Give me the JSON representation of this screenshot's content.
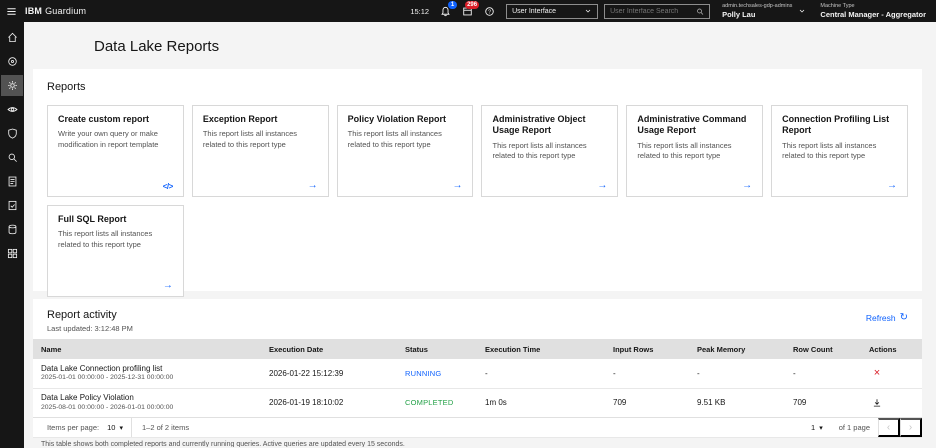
{
  "colors": {
    "accent_blue": "#0f62fe",
    "status_running": "#0f62fe",
    "status_completed": "#24a148",
    "danger_red": "#da1e28"
  },
  "topbar": {
    "brand_bold": "IBM",
    "brand_rest": "Guardium",
    "time": "15:12",
    "notifications_badge": "1",
    "tasks_badge": "296",
    "ui_selector_value": "User Interface",
    "search_placeholder": "User Interface Search",
    "user_group": "admin.techsales-gdp-admins",
    "user_name": "Polly Lau",
    "machine_type_label": "Machine Type",
    "machine_type_value": "Central Manager - Aggregator"
  },
  "sidebar": {
    "items": [
      {
        "name": "home",
        "active": false
      },
      {
        "name": "discover",
        "active": false
      },
      {
        "name": "settings",
        "active": true
      },
      {
        "name": "monitor",
        "active": false
      },
      {
        "name": "protect",
        "active": false
      },
      {
        "name": "search",
        "active": false
      },
      {
        "name": "reports",
        "active": false
      },
      {
        "name": "audit",
        "active": false
      },
      {
        "name": "data",
        "active": false
      },
      {
        "name": "dashboards",
        "active": false
      }
    ]
  },
  "page": {
    "title": "Data Lake Reports"
  },
  "reports": {
    "section_title": "Reports",
    "cards": [
      {
        "title": "Create custom report",
        "description": "Write your own query or make modification in report template",
        "icon": "code-icon",
        "icon_glyph": "</>"
      },
      {
        "title": "Exception Report",
        "description": "This report lists all instances related to this report type",
        "icon": "arrow-right-icon",
        "icon_glyph": "→"
      },
      {
        "title": "Policy Violation Report",
        "description": "This report lists all instances related to this report type",
        "icon": "arrow-right-icon",
        "icon_glyph": "→"
      },
      {
        "title": "Administrative Object Usage Report",
        "description": "This report lists all instances related to this report type",
        "icon": "arrow-right-icon",
        "icon_glyph": "→"
      },
      {
        "title": "Administrative Command Usage Report",
        "description": "This report lists all instances related to this report type",
        "icon": "arrow-right-icon",
        "icon_glyph": "→"
      },
      {
        "title": "Connection Profiling List Report",
        "description": "This report lists all instances related to this report type",
        "icon": "arrow-right-icon",
        "icon_glyph": "→"
      },
      {
        "title": "Full SQL Report",
        "description": "This report lists all instances related to this report type",
        "icon": "arrow-right-icon",
        "icon_glyph": "→"
      }
    ]
  },
  "activity": {
    "section_title": "Report activity",
    "last_updated": "Last updated: 3:12:48 PM",
    "refresh_label": "Refresh",
    "table": {
      "headers": [
        "Name",
        "Execution Date",
        "Status",
        "Execution Time",
        "Input Rows",
        "Peak Memory",
        "Row Count",
        "Actions"
      ],
      "rows": [
        {
          "name": "Data Lake Connection profiling list",
          "period": "2025-01-01 00:00:00 - 2025-12-31 00:00:00",
          "execution_date": "2026-01-22 15:12:39",
          "status": "RUNNING",
          "execution_time": "-",
          "input_rows": "-",
          "peak_memory": "-",
          "row_count": "-",
          "action": "cancel"
        },
        {
          "name": "Data Lake Policy Violation",
          "period": "2025-08-01 00:00:00 - 2026-01-01 00:00:00",
          "execution_date": "2026-01-19 18:10:02",
          "status": "COMPLETED",
          "execution_time": "1m 0s",
          "input_rows": "709",
          "peak_memory": "9.51 KB",
          "row_count": "709",
          "action": "download"
        }
      ]
    },
    "pagination": {
      "items_per_page_label": "Items per page:",
      "items_per_page_value": "10",
      "range_text": "1–2 of 2 items",
      "page_value": "1",
      "page_text": "of 1 page"
    },
    "footnote": "This table shows both completed reports and currently running queries. Active queries are updated every 15 seconds."
  }
}
